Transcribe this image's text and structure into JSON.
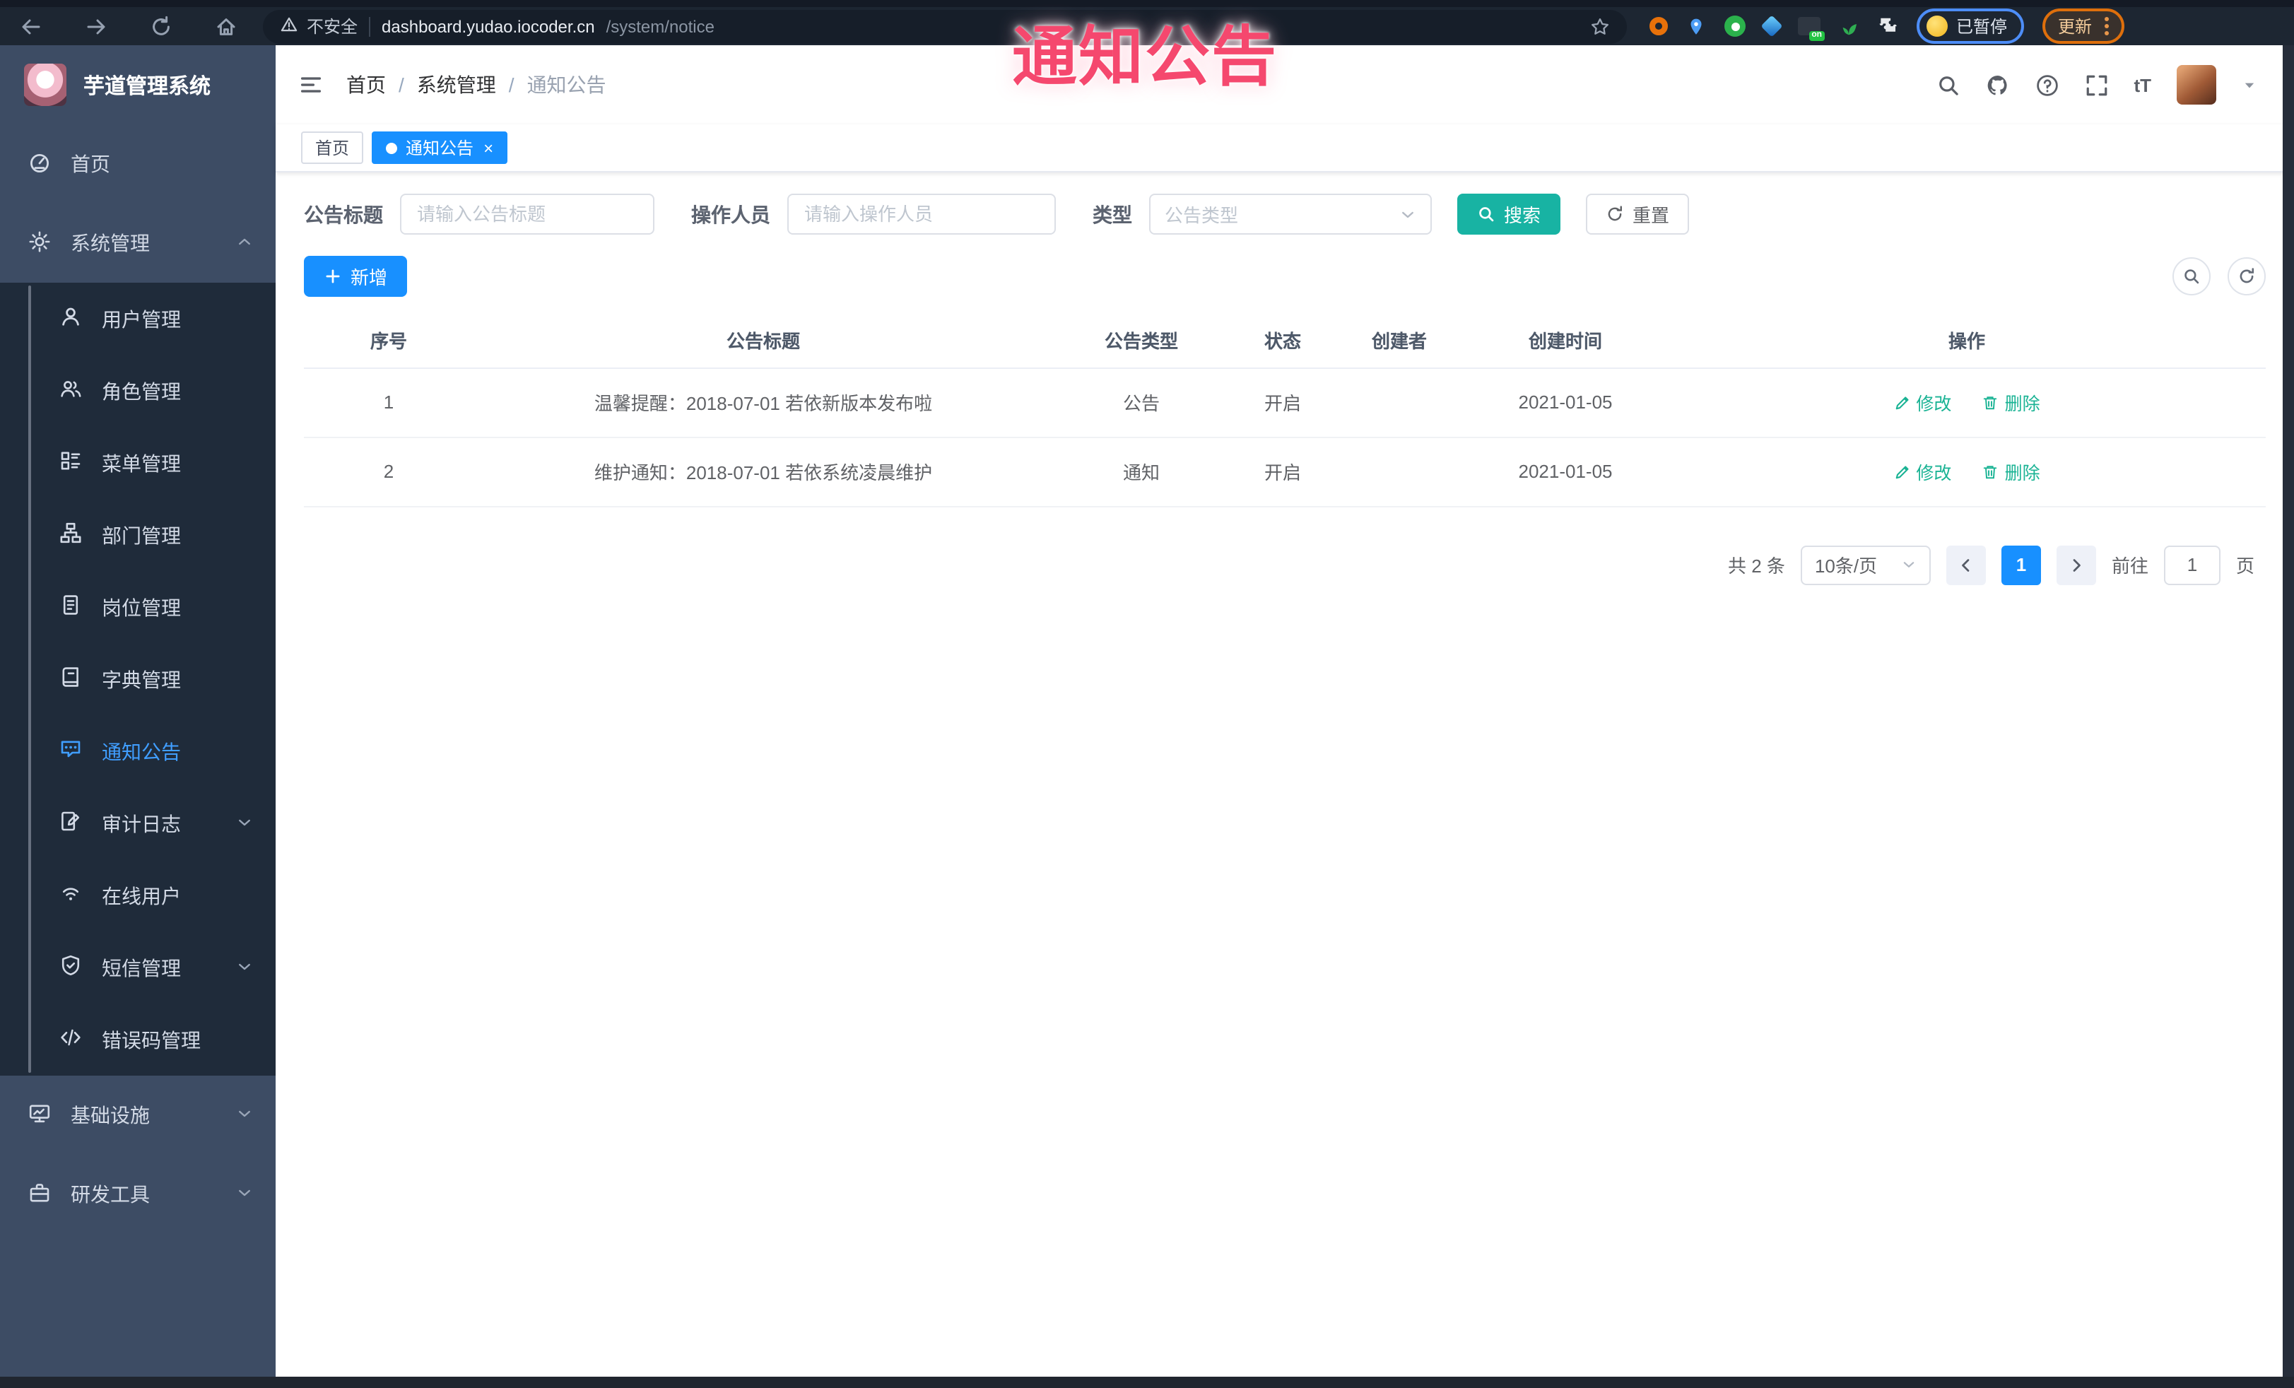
{
  "browser": {
    "warning_label": "不安全",
    "url_host": "dashboard.yudao.iocoder.cn",
    "url_path": "/system/notice",
    "paused_badge": "已暂停",
    "update_button": "更新",
    "on_badge": "on"
  },
  "watermark": "通知公告",
  "sidebar": {
    "logo_title": "芋道管理系统",
    "items": [
      {
        "label": "首页"
      },
      {
        "label": "系统管理",
        "expanded": true
      },
      {
        "label": "用户管理"
      },
      {
        "label": "角色管理"
      },
      {
        "label": "菜单管理"
      },
      {
        "label": "部门管理"
      },
      {
        "label": "岗位管理"
      },
      {
        "label": "字典管理"
      },
      {
        "label": "通知公告",
        "active": true
      },
      {
        "label": "审计日志",
        "collapsible": true
      },
      {
        "label": "在线用户"
      },
      {
        "label": "短信管理",
        "collapsible": true
      },
      {
        "label": "错误码管理"
      },
      {
        "label": "基础设施",
        "collapsible": true
      },
      {
        "label": "研发工具",
        "collapsible": true
      }
    ]
  },
  "header": {
    "breadcrumb": [
      "首页",
      "系统管理",
      "通知公告"
    ],
    "font_size_tool": "tT"
  },
  "tags": [
    {
      "label": "首页",
      "active": false
    },
    {
      "label": "通知公告",
      "active": true
    }
  ],
  "filters": {
    "title_label": "公告标题",
    "title_placeholder": "请输入公告标题",
    "operator_label": "操作人员",
    "operator_placeholder": "请输入操作人员",
    "type_label": "类型",
    "type_placeholder": "公告类型",
    "search_label": "搜索",
    "reset_label": "重置"
  },
  "toolbar": {
    "add_label": "新增"
  },
  "table": {
    "columns": [
      "序号",
      "公告标题",
      "公告类型",
      "状态",
      "创建者",
      "创建时间",
      "操作"
    ],
    "rows": [
      {
        "no": "1",
        "title": "温馨提醒：2018-07-01 若依新版本发布啦",
        "type": "公告",
        "status": "开启",
        "creator": "",
        "created": "2021-01-05"
      },
      {
        "no": "2",
        "title": "维护通知：2018-07-01 若依系统凌晨维护",
        "type": "通知",
        "status": "开启",
        "creator": "",
        "created": "2021-01-05"
      }
    ],
    "actions": {
      "edit": "修改",
      "delete": "删除"
    }
  },
  "pagination": {
    "total": "共 2 条",
    "page_size": "10条/页",
    "current_page": "1",
    "goto_label": "前往",
    "goto_value": "1",
    "page_unit": "页"
  },
  "icons": {
    "search": "magnifier",
    "refresh": "circular-arrow",
    "add": "plus",
    "edit": "pencil",
    "delete": "trash-can",
    "close": "x",
    "active-dot": "circle",
    "browser-nav": [
      "back-arrow",
      "forward-arrow",
      "reload",
      "home"
    ],
    "warning": "triangle-exclamation",
    "bookmark": "star-outline",
    "header": [
      "magnifier",
      "github-octocat",
      "question-circle",
      "fullscreen-arrows",
      "font-size-tT",
      "avatar",
      "caret-down"
    ]
  },
  "colors": {
    "primary_blue": "#1890ff",
    "search_teal": "#18b3a3",
    "action_green": "#1ab394",
    "sidebar_bg": "#3d4c64",
    "submenu_bg": "#1f2b3a",
    "active_menu_text": "#409eff",
    "watermark_pink": "#f5486e",
    "browser_bar": "#1d2632",
    "update_orange": "#de6f0c",
    "paused_blue_border": "#4d8df7"
  }
}
